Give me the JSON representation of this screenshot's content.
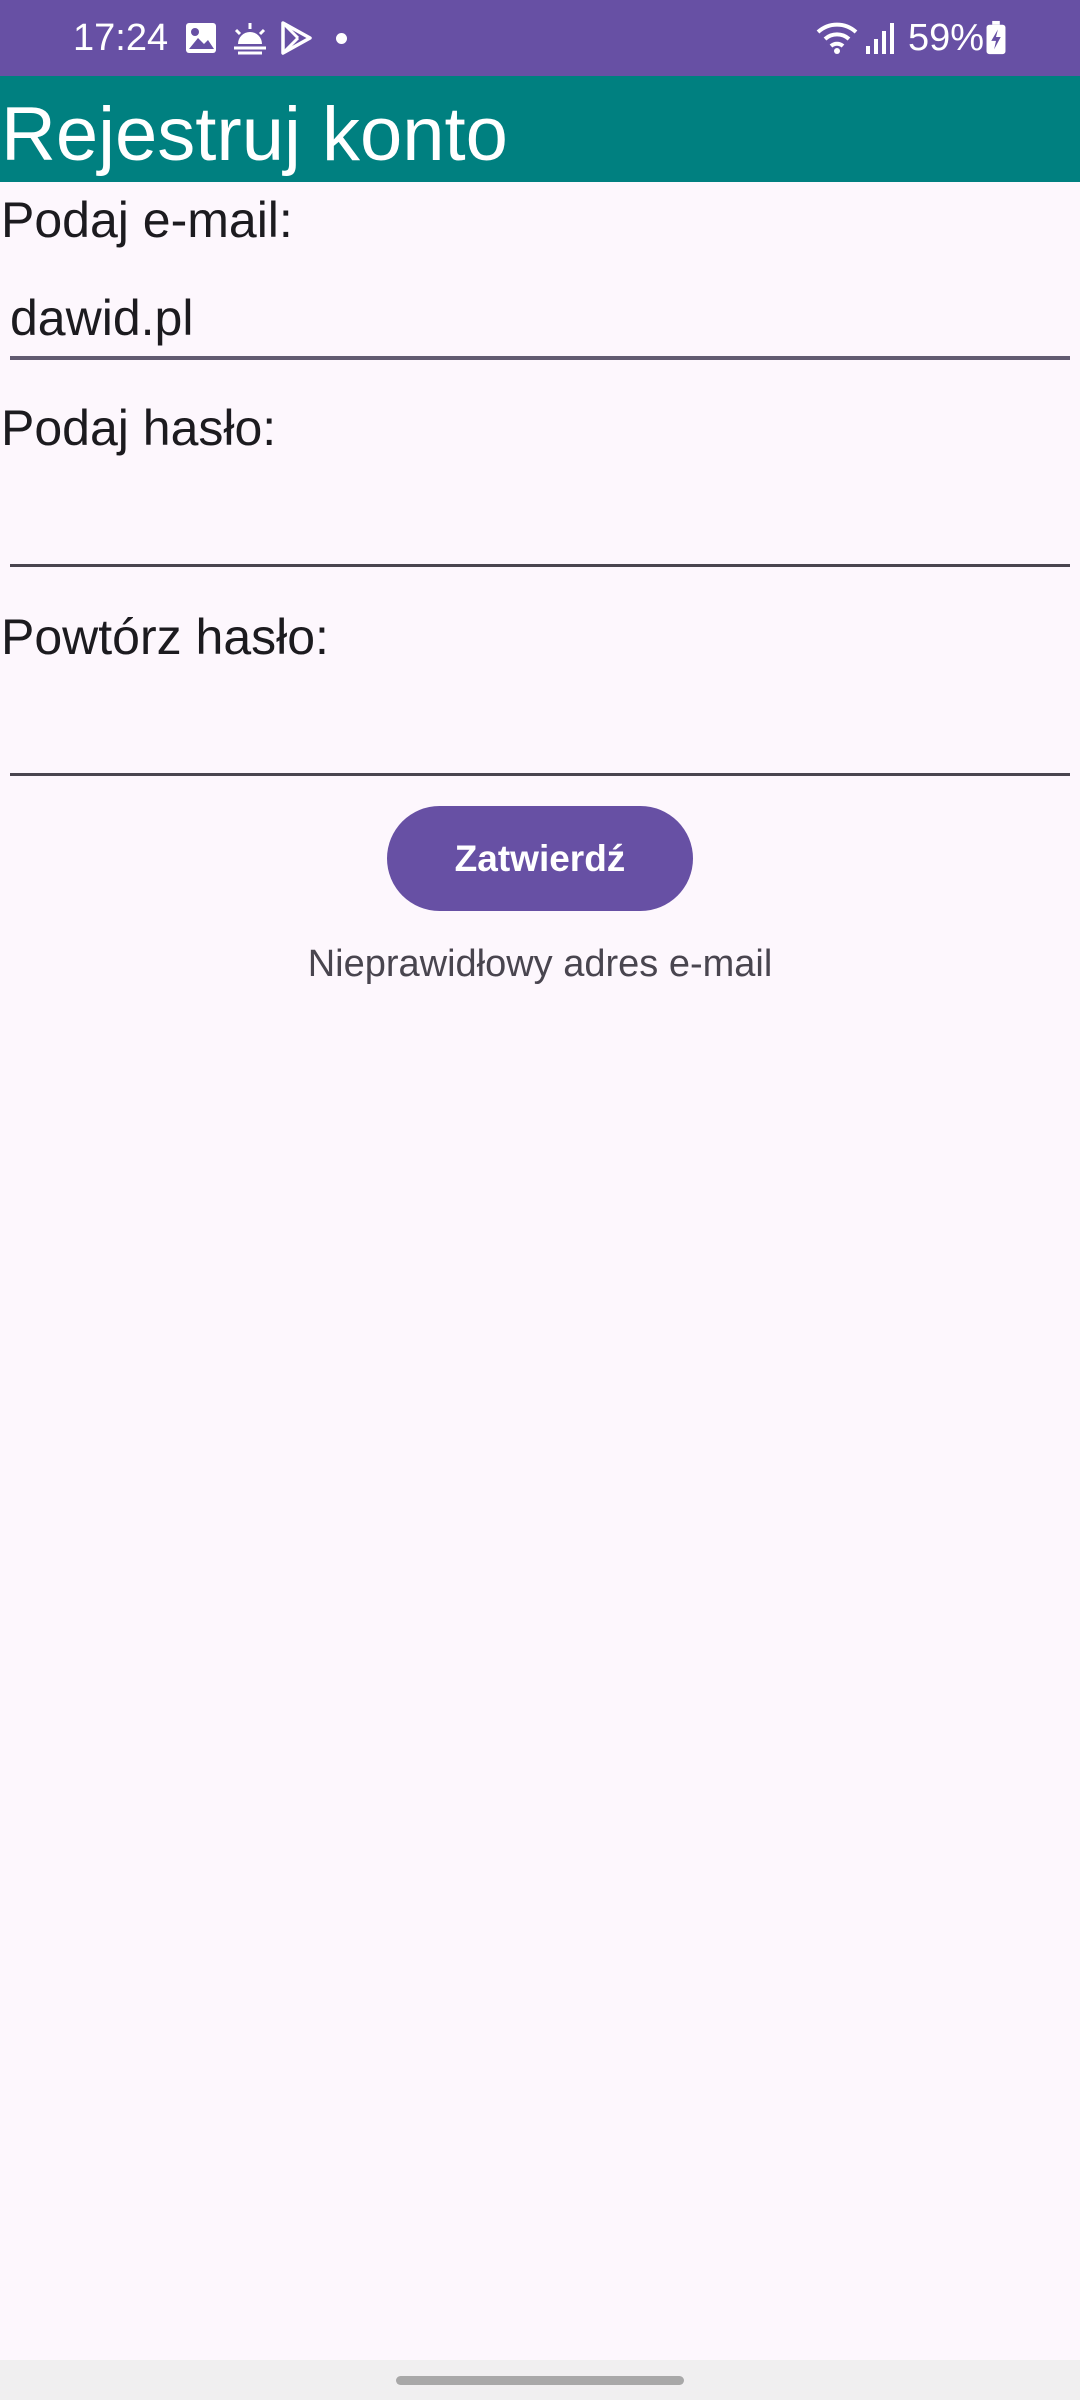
{
  "status_bar": {
    "time": "17:24",
    "icons_left": [
      "gallery-icon",
      "weather-icon",
      "play-store-icon",
      "dot-icon"
    ],
    "icons_right": [
      "wifi-icon",
      "signal-icon",
      "battery-icon"
    ],
    "battery_percent": "59%",
    "background_color": "#6750a4"
  },
  "app_bar": {
    "title": "Rejestruj konto",
    "background_color": "#008080"
  },
  "form": {
    "email_label": "Podaj e-mail:",
    "email_value": "dawid.pl",
    "password_label": "Podaj hasło:",
    "password_value": "",
    "repeat_password_label": "Powtórz hasło:",
    "repeat_password_value": "",
    "submit_label": "Zatwierdź",
    "error_message": "Nieprawidłowy adres e-mail",
    "accent_color": "#6750a4"
  }
}
